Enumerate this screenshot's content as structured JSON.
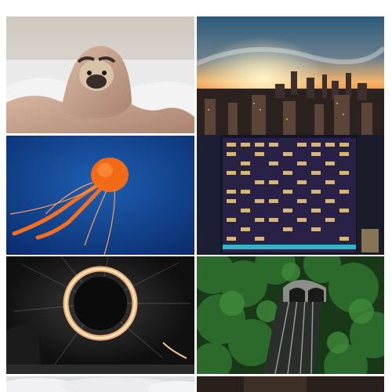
{
  "gallery": {
    "tiles": [
      {
        "name": "pug-in-blanket-photo",
        "accent": "#b79a84"
      },
      {
        "name": "city-sunset-aerial-photo",
        "accent": "#e08d3c"
      },
      {
        "name": "orange-jellyfish-photo",
        "accent": "#f06a1a"
      },
      {
        "name": "lit-apartment-building-photo",
        "accent": "#3a2b5e"
      },
      {
        "name": "steel-wool-light-painting-photo",
        "accent": "#f2b27a"
      },
      {
        "name": "forest-tunnel-aerial-photo",
        "accent": "#2f6b2f"
      },
      {
        "name": "clouds-photo",
        "accent": "#e7e7ea"
      },
      {
        "name": "dark-photo",
        "accent": "#3a2a22"
      }
    ]
  }
}
